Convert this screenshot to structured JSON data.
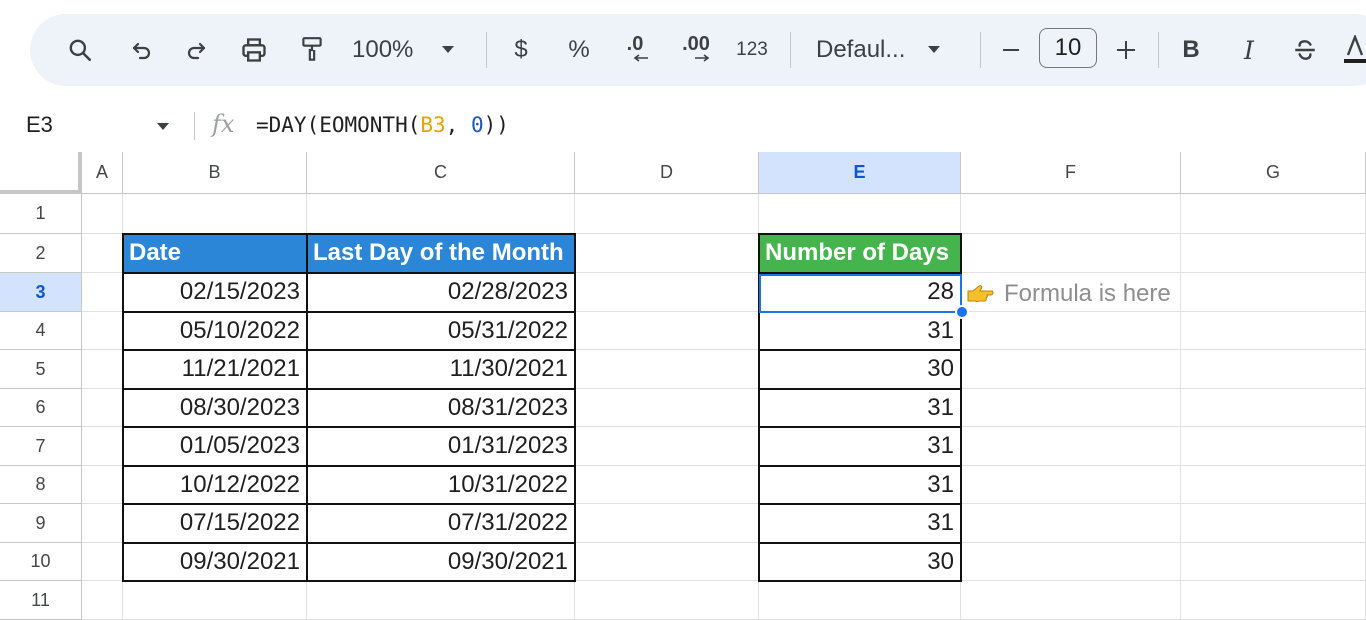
{
  "toolbar": {
    "zoom": "100%",
    "currency_label": "$",
    "percent_label": "%",
    "decrease_decimal_label": ".0",
    "increase_decimal_label": ".00",
    "number_format_label": "123",
    "font_name": "Defaul...",
    "font_size": "10",
    "bold_label": "B",
    "italic_label": "I"
  },
  "formula_bar": {
    "name_box": "E3",
    "fx_label": "fx",
    "formula_prefix": "=DAY(EOMONTH(",
    "formula_ref": "B3",
    "formula_sep": ", ",
    "formula_num": "0",
    "formula_suffix": "))"
  },
  "columns": [
    "A",
    "B",
    "C",
    "D",
    "E",
    "F",
    "G"
  ],
  "rows": [
    "1",
    "2",
    "3",
    "4",
    "5",
    "6",
    "7",
    "8",
    "9",
    "10",
    "11"
  ],
  "selected": {
    "column": "E",
    "row": "3"
  },
  "table_dates": {
    "headers": [
      "Date",
      "Last Day of the Month"
    ],
    "rows": [
      [
        "02/15/2023",
        "02/28/2023"
      ],
      [
        "05/10/2022",
        "05/31/2022"
      ],
      [
        "11/21/2021",
        "11/30/2021"
      ],
      [
        "08/30/2023",
        "08/31/2023"
      ],
      [
        "01/05/2023",
        "01/31/2023"
      ],
      [
        "10/12/2022",
        "10/31/2022"
      ],
      [
        "07/15/2022",
        "07/31/2022"
      ],
      [
        "09/30/2021",
        "09/30/2021"
      ]
    ]
  },
  "table_days": {
    "header": "Number of Days",
    "values": [
      "28",
      "31",
      "30",
      "31",
      "31",
      "31",
      "31",
      "30"
    ]
  },
  "annotation": {
    "text": "Formula is here",
    "icon": "pointing-hand-icon"
  },
  "colors": {
    "date_header_bg": "#2c86d8",
    "days_header_bg": "#46b44c",
    "selection": "#1a73e8",
    "header_highlight": "#d3e3fd"
  }
}
